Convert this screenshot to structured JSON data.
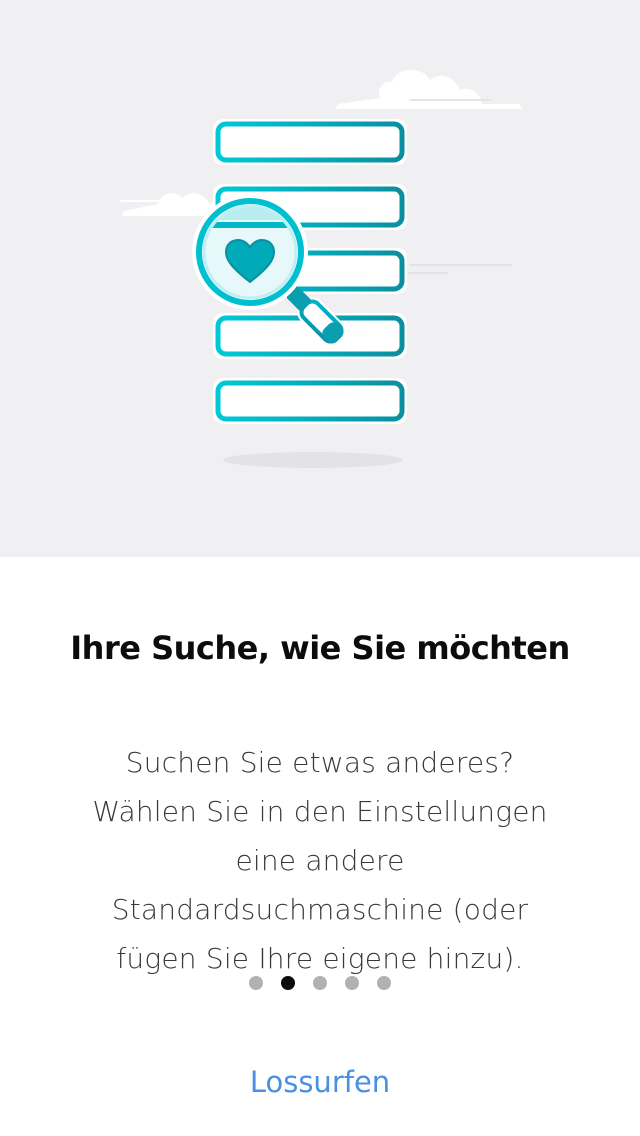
{
  "illustration": {
    "name": "search-illustration",
    "icons": [
      "magnifier-icon",
      "heart-icon",
      "cloud-icon"
    ],
    "colors": {
      "background": "#f0f0f2",
      "accent": "#00c8d7",
      "accent_dark": "#0a8fa0"
    }
  },
  "onboarding": {
    "title": "Ihre Suche, wie Sie möchten",
    "description_lines": [
      "Suchen Sie etwas anderes?",
      "Wählen Sie in den Einstellungen",
      "eine andere",
      "Standardsuchmaschine (oder",
      "fügen Sie Ihre eigene hinzu)."
    ],
    "page_indicator": {
      "total": 5,
      "current": 2
    },
    "cta_label": "Lossurfen",
    "cta_color": "#4a90e2"
  }
}
